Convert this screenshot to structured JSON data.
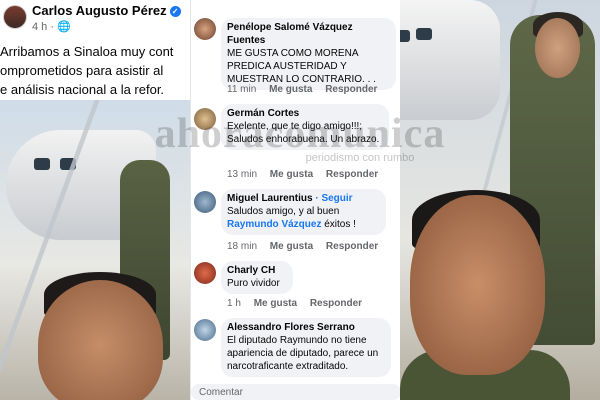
{
  "post": {
    "author": "Carlos Augusto Pérez",
    "time": "4 h ·",
    "text_lines": [
      "Arribamos a Sinaloa muy cont",
      "omprometidos para asistir al",
      "e análisis nacional  a la refor."
    ]
  },
  "comments": [
    {
      "author": "Penélope Salomé Vázquez Fuentes",
      "text": "ME GUSTA COMO MORENA PREDICA AUSTERIDAD Y MUESTRAN LO  CONTRARIO. . .",
      "time": "11 min",
      "like": "Me gusta",
      "reply": "Responder"
    },
    {
      "author": "Germán Cortes",
      "text": "Exelente, que te digo amigo!!!; Saludos enhorabuena. Un abrazo.",
      "time": "13 min",
      "like": "Me gusta",
      "reply": "Responder"
    },
    {
      "author": "Miguel Laurentius",
      "follow": "· Seguir",
      "text_before": "Saludos amigo,  y al buen",
      "mention": "Raymundo Vázquez",
      "text_after": " éxitos !",
      "time": "18 min",
      "like": "Me gusta",
      "reply": "Responder"
    },
    {
      "author": "Charly CH",
      "text": "Puro vividor",
      "time": "1 h",
      "like": "Me gusta",
      "reply": "Responder"
    },
    {
      "author": "Alessandro Flores Serrano",
      "text": "El diputado Raymundo no tiene apariencia de diputado,  parece un narcotraficante extraditado."
    }
  ],
  "composer": {
    "placeholder": "Comentar"
  },
  "watermark": {
    "brand": "ahoracomunica",
    "tagline": "periodismo con rumbo"
  },
  "colors": {
    "link": "#1877f2",
    "bubble": "#f0f2f5",
    "meta": "#65676b"
  }
}
